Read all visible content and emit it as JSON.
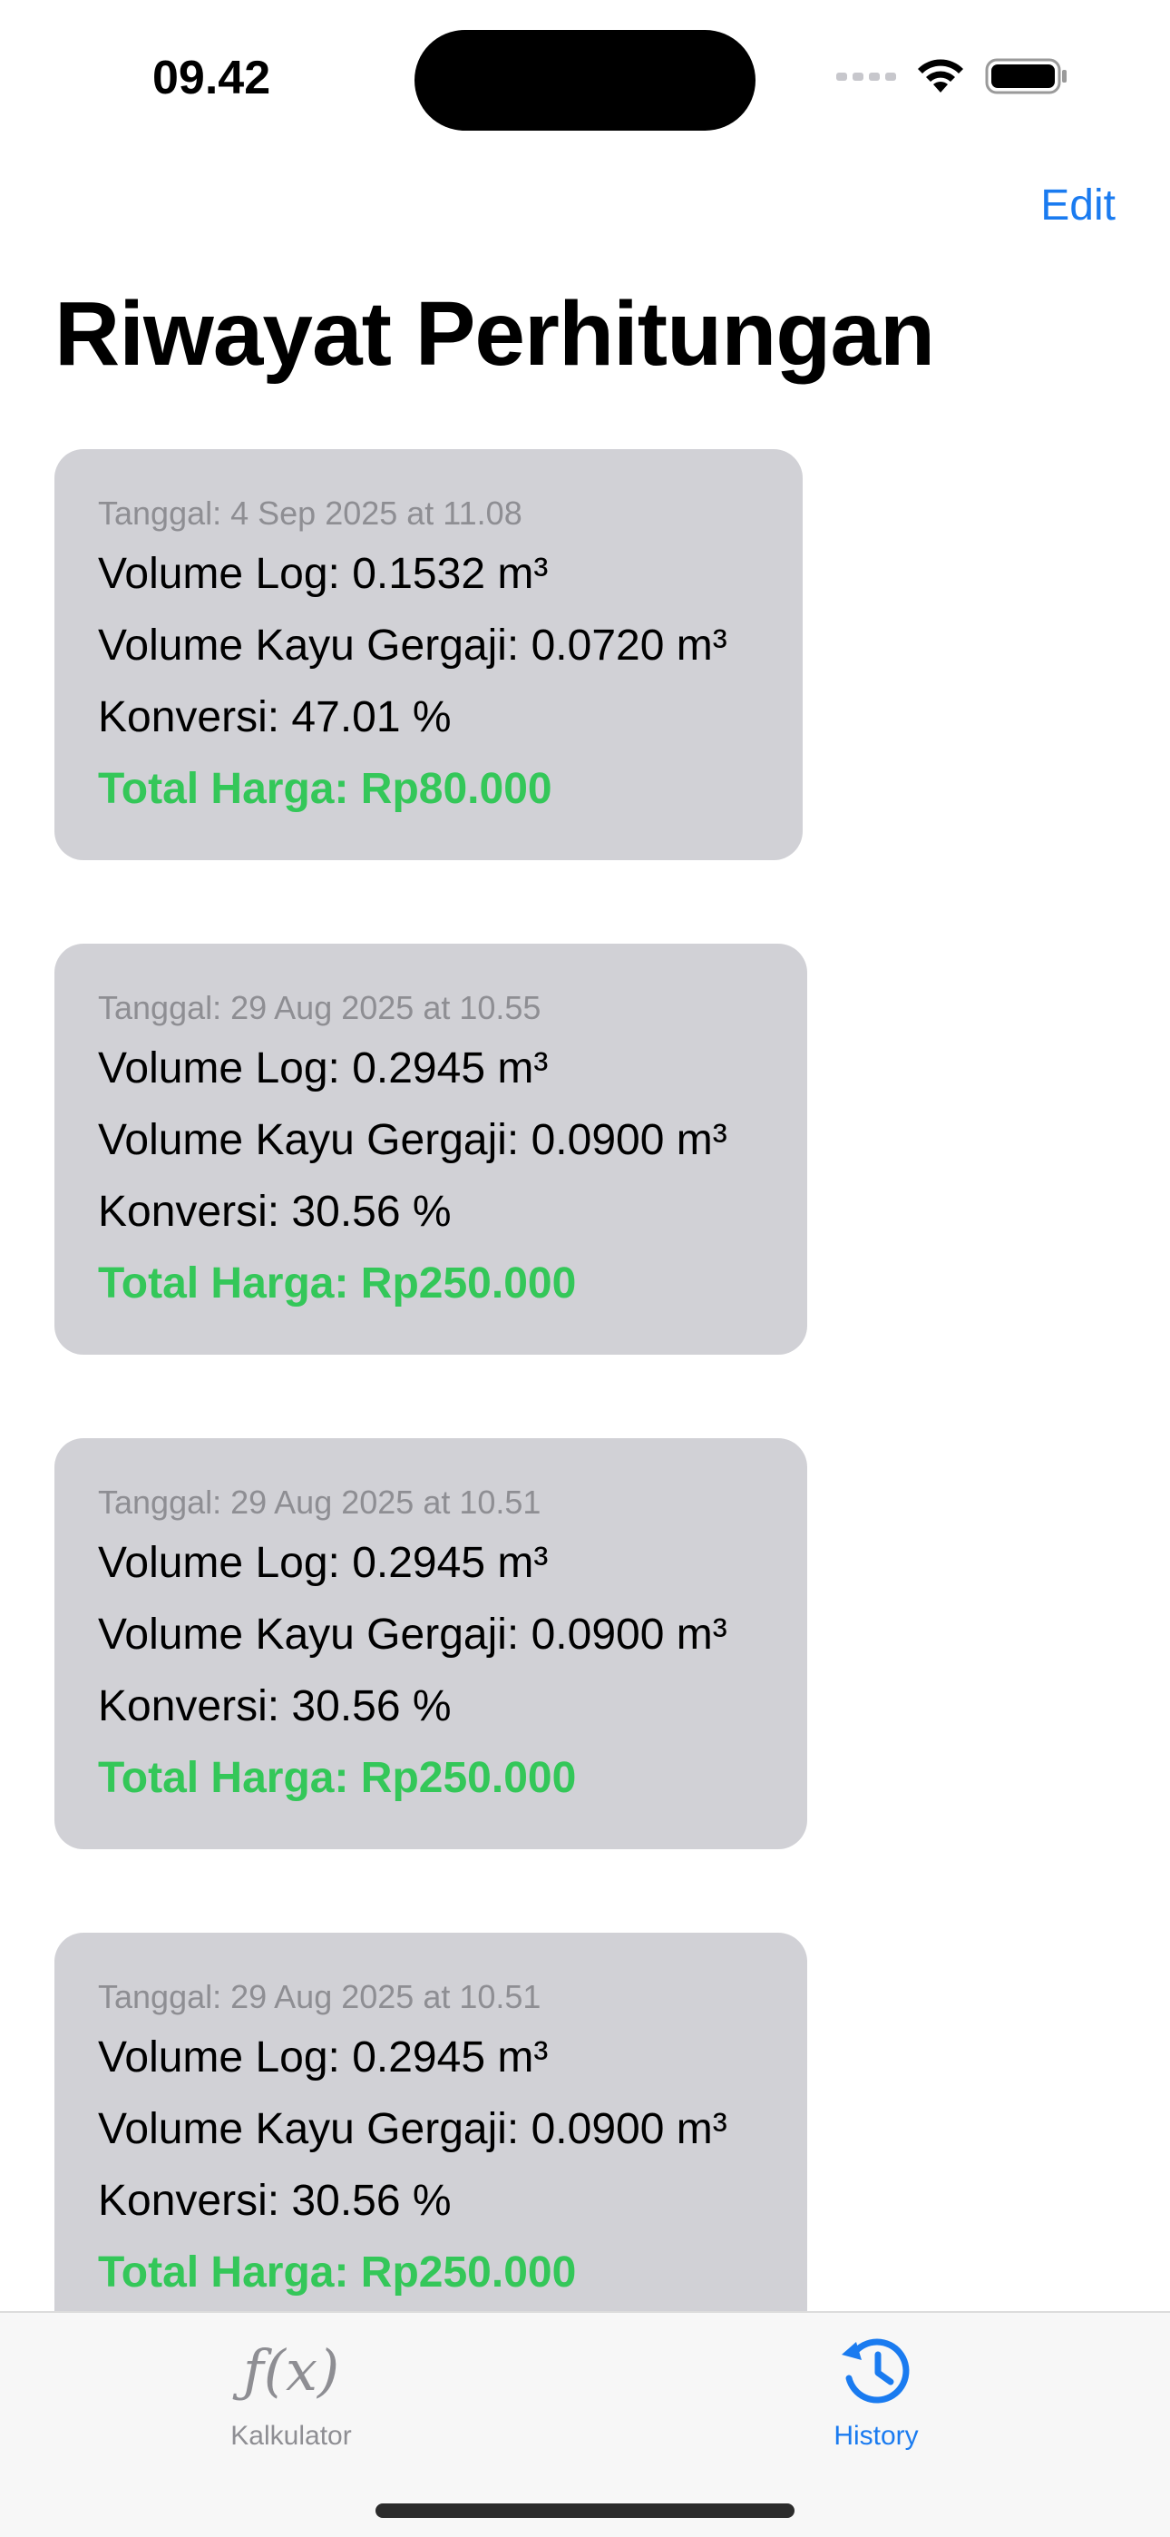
{
  "status_bar": {
    "time": "09.42"
  },
  "nav": {
    "edit_label": "Edit",
    "title": "Riwayat Perhitungan"
  },
  "colors": {
    "accent": "#1a7bf0",
    "total_green": "#34c759",
    "card_bg": "#d1d1d6"
  },
  "history": [
    {
      "date": "Tanggal: 4 Sep 2025 at 11.08",
      "volume_log": "Volume Log: 0.1532 m³",
      "volume_kayu": "Volume Kayu Gergaji: 0.0720 m³",
      "konversi": "Konversi: 47.01 %",
      "total": "Total Harga: Rp80.000"
    },
    {
      "date": "Tanggal: 29 Aug 2025 at 10.55",
      "volume_log": "Volume Log: 0.2945 m³",
      "volume_kayu": "Volume Kayu Gergaji: 0.0900 m³",
      "konversi": "Konversi: 30.56 %",
      "total": "Total Harga: Rp250.000"
    },
    {
      "date": "Tanggal: 29 Aug 2025 at 10.51",
      "volume_log": "Volume Log: 0.2945 m³",
      "volume_kayu": "Volume Kayu Gergaji: 0.0900 m³",
      "konversi": "Konversi: 30.56 %",
      "total": "Total Harga: Rp250.000"
    },
    {
      "date": "Tanggal: 29 Aug 2025 at 10.51",
      "volume_log": "Volume Log: 0.2945 m³",
      "volume_kayu": "Volume Kayu Gergaji: 0.0900 m³",
      "konversi": "Konversi: 30.56 %",
      "total": "Total Harga: Rp250.000"
    }
  ],
  "tab_bar": {
    "tabs": [
      {
        "label": "Kalkulator",
        "icon": "function-icon",
        "glyph": "ƒ(x)",
        "active": false
      },
      {
        "label": "History",
        "icon": "history-clock-icon",
        "active": true
      }
    ]
  }
}
